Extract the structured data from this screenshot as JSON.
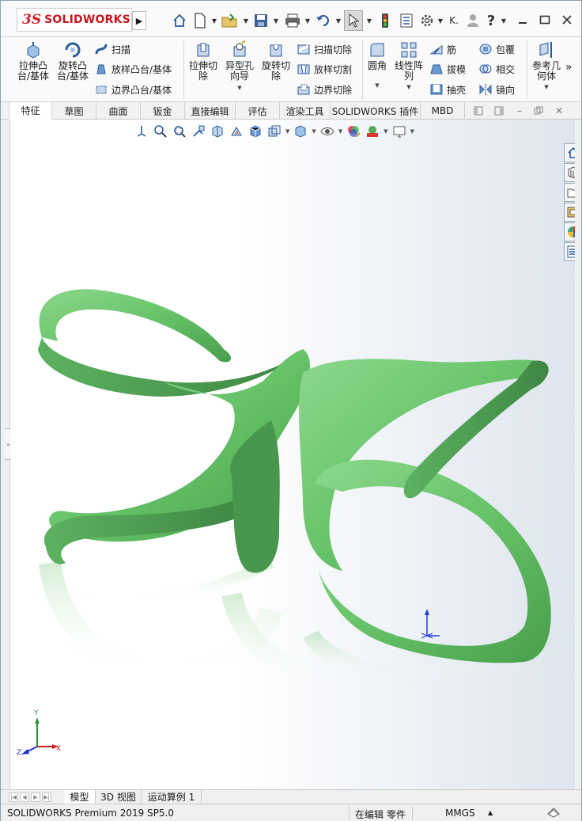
{
  "app": {
    "logo_prefix": "3S",
    "logo_name": "SOLIDWORKS"
  },
  "quick_access": {
    "user_label": "K."
  },
  "ribbon": {
    "extrude_boss": "拉伸凸\n台/基体",
    "revolve_boss": "旋转凸\n台/基体",
    "sweep": "扫描",
    "loft_boss": "放样凸台/基体",
    "boundary_boss": "边界凸台/基体",
    "extrude_cut": "拉伸切\n除",
    "hole_wizard": "异型孔\n向导",
    "revolve_cut": "旋转切\n除",
    "swept_cut": "扫描切除",
    "lofted_cut": "放样切割",
    "boundary_cut": "边界切除",
    "fillet": "圆角",
    "linear_pattern": "线性阵\n列",
    "rib": "筋",
    "draft": "拔模",
    "shell": "抽壳",
    "wrap": "包覆",
    "intersect": "相交",
    "mirror": "镜向",
    "reference_geometry": "参考几\n何体"
  },
  "tabs": [
    "特征",
    "草图",
    "曲面",
    "钣金",
    "直接编辑",
    "评估",
    "渲染工具",
    "SOLIDWORKS 插件",
    "MBD"
  ],
  "bottom_tabs": [
    "模型",
    "3D 视图",
    "运动算例 1"
  ],
  "status": {
    "product": "SOLIDWORKS Premium 2019 SP5.0",
    "mode": "在编辑 零件",
    "units": "MMGS"
  },
  "colors": {
    "model_green": "#6cc86e",
    "brand_red": "#c8141e",
    "accent_blue": "#2b5c9e"
  },
  "triad": {
    "x": "X",
    "y": "Y",
    "z": "Z"
  }
}
